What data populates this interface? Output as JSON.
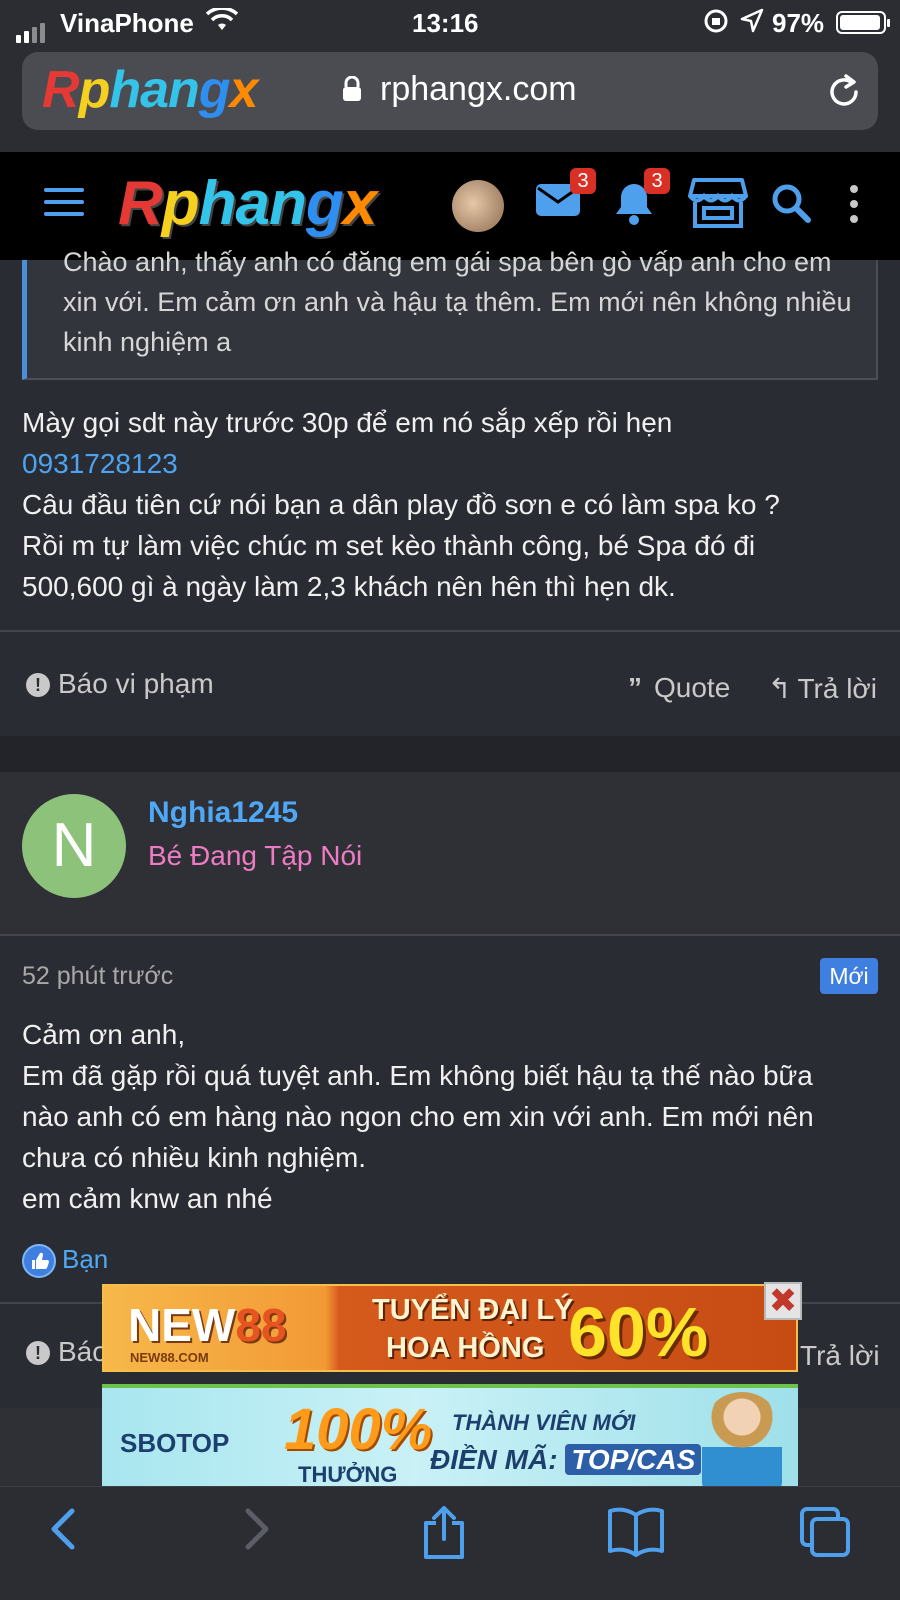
{
  "status_bar": {
    "carrier": "VinaPhone",
    "time": "13:16",
    "battery": "97%"
  },
  "browser": {
    "url": "rphangx.com",
    "url_logo": "Rphangx"
  },
  "site_header": {
    "logo": {
      "r": "R",
      "p": "p",
      "h": "han",
      "g": "g",
      "x": "x"
    },
    "messages_count": "3",
    "alerts_count": "3"
  },
  "quoted_post": {
    "text": "Chào anh, thấy anh có đăng em gái spa bên gò vấp anh cho em xin với. Em cảm ơn anh và hậu tạ thêm. Em mới nên không nhiều kinh nghiệm a"
  },
  "reply_post": {
    "line1": "Mày gọi sdt này trước 30p để em nó sắp xếp rồi hẹn",
    "phone": "0931728123",
    "line2": "Câu đầu tiên cứ nói bạn a dân play đồ sơn e có làm spa ko ?",
    "line3": "Rồi m tự làm việc chúc m set kèo thành công, bé Spa đó đi",
    "line4": "500,600 gì à ngày làm 2,3 khách nên hên thì hẹn dk."
  },
  "actions": {
    "report": "Báo vi phạm",
    "report_short": "Báo",
    "quote": "Quote",
    "reply": "Trả lời"
  },
  "user": {
    "initial": "N",
    "name": "Nghia1245",
    "title": "Bé Đang Tập Nói"
  },
  "post2": {
    "time": "52 phút trước",
    "badge": "Mới",
    "line1": "Cảm ơn anh,",
    "line2": "Em đã gặp rồi quá tuyệt anh. Em không biết hậu tạ thế nào bữa",
    "line3": "nào anh có em hàng nào ngon cho em xin với anh. Em mới nên",
    "line4": "chưa có nhiều kinh nghiệm.",
    "line5": "em cảm knw an nhé",
    "reaction": "Bạn"
  },
  "ads": {
    "ad1": {
      "brand_a": "NEW",
      "brand_b": "88",
      "domain": "NEW88.COM",
      "line1": "TUYỂN ĐẠI LÝ",
      "line2": "HOA HỒNG",
      "percent": "60%"
    },
    "ad2": {
      "brand": "SBOTOP",
      "hundred": "100%",
      "bonus": "THƯỞNG",
      "member": "THÀNH VIÊN MỚI",
      "code_label": "ĐIỀN MÃ:",
      "code": "TOP/CAS"
    },
    "close": "✖"
  },
  "colors": {
    "accent": "#4fa8f5",
    "user_title": "#ee7cc4",
    "badge": "#d93025",
    "new_badge": "#3f7fe0"
  }
}
